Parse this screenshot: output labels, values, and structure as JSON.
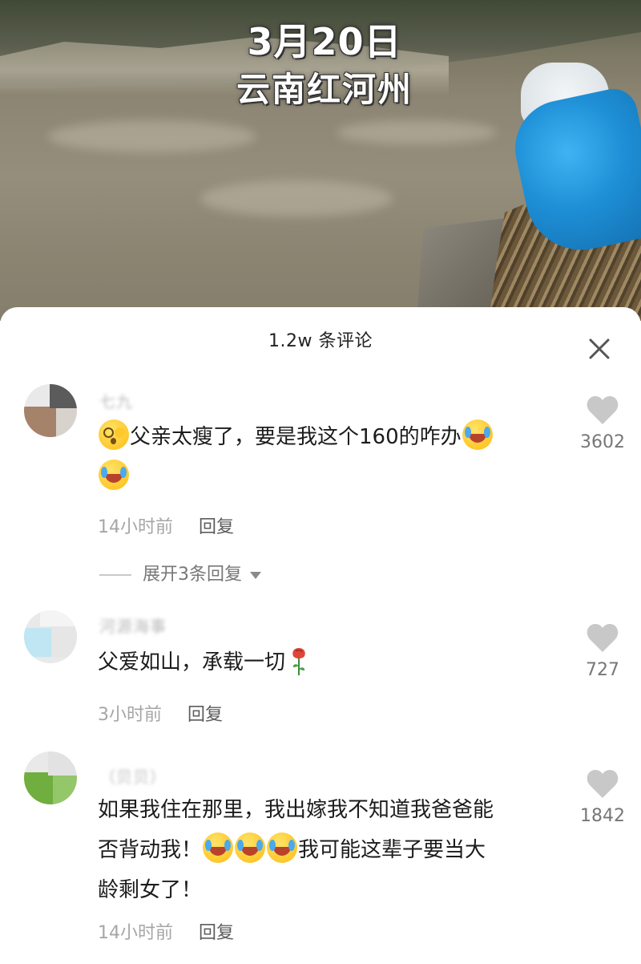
{
  "video": {
    "date_text": "3月20日",
    "place_text": "云南红河州"
  },
  "comments_header": {
    "title": "1.2w 条评论",
    "close_icon": "close-icon"
  },
  "comments": [
    {
      "text_part1": "父亲太瘦了，要是我这个160的咋办",
      "emojis": [
        "shock-emoji",
        "laugh-cry-emoji",
        "laugh-cry-emoji"
      ],
      "time": "14小时前",
      "reply_label": "回复",
      "likes": "3602",
      "expand_label": "展开3条回复"
    },
    {
      "text_part1": "父爱如山，承载一切",
      "emojis": [
        "rose-emoji"
      ],
      "time": "3小时前",
      "reply_label": "回复",
      "likes": "727"
    },
    {
      "text_line1": "如果我住在那里，我出嫁我不知道我爸爸能",
      "text_line2a": "否背动我！",
      "text_line2b": "我可能这辈子要当大",
      "text_line3": "龄剩女了！",
      "emojis": [
        "laugh-cry-emoji",
        "laugh-cry-emoji",
        "laugh-cry-emoji"
      ],
      "time": "14小时前",
      "reply_label": "回复",
      "likes": "1842"
    }
  ],
  "colors": {
    "like_icon": "#c8c8c8",
    "meta_text": "#a6a6a6",
    "bag_blue": "#1e8fd6"
  }
}
